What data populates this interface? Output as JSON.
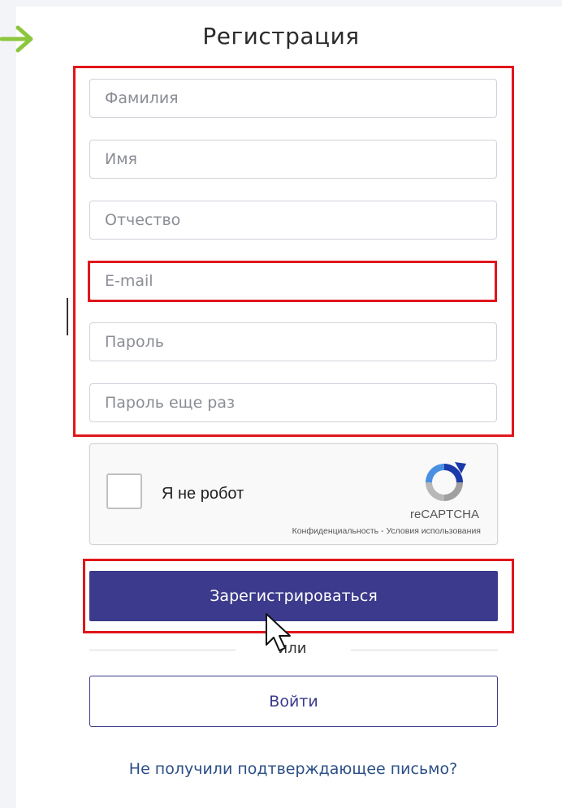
{
  "page": {
    "title": "Регистрация"
  },
  "form": {
    "fields": [
      {
        "placeholder": "Фамилия",
        "value": ""
      },
      {
        "placeholder": "Имя",
        "value": ""
      },
      {
        "placeholder": "Отчество",
        "value": ""
      },
      {
        "placeholder": "E-mail",
        "value": ""
      },
      {
        "placeholder": "Пароль",
        "value": ""
      },
      {
        "placeholder": "Пароль еще раз",
        "value": ""
      }
    ]
  },
  "captcha": {
    "checkbox_label": "Я не робот",
    "brand": "reCAPTCHA",
    "privacy_link": "Конфиденциальность",
    "separator": " - ",
    "terms_link": "Условия использования",
    "checked": false
  },
  "actions": {
    "register_label": "Зарегистрироваться",
    "or_label": "или",
    "login_label": "Войти",
    "resend_link": "Не получили подтверждающее письмо?"
  },
  "colors": {
    "primary": "#3b3a8c",
    "highlight": "#e0161b",
    "arrow": "#8cc63f",
    "link": "#2b4f86"
  },
  "icons": [
    "arrow-right-icon",
    "recaptcha-icon",
    "mouse-pointer-icon"
  ]
}
